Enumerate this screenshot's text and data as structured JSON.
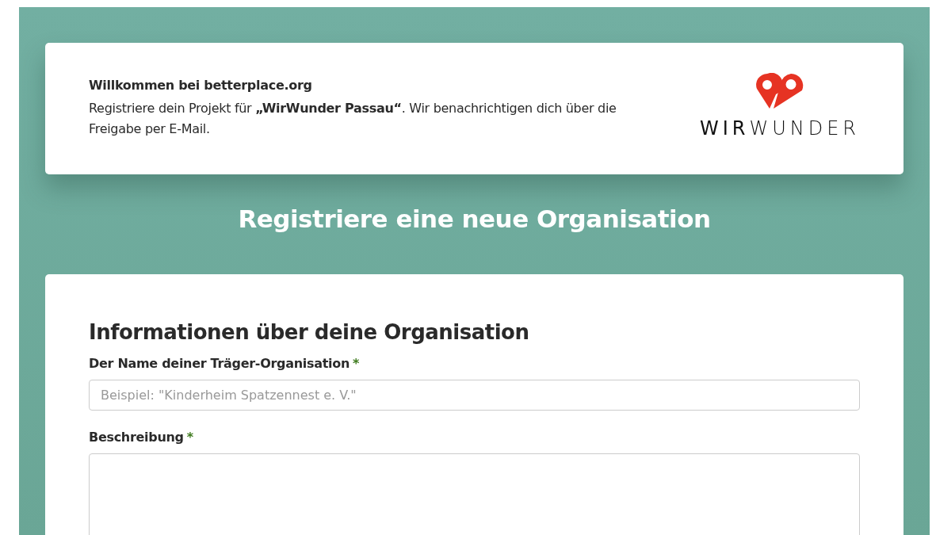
{
  "welcome": {
    "title": "Willkommen bei betterplace.org",
    "text": "Registriere dein Projekt für **„WirWunder Passau“**. Wir benachrichtigen dich über die Freigabe per E-Mail.",
    "logo_text": "**WIR**WUNDER"
  },
  "page_title": "Registriere eine neue Organisation",
  "form": {
    "section_title": "Informationen über deine Organisation",
    "fields": [
      {
        "kind": "input",
        "label": "Der Name deiner Träger-Organisation",
        "required": true,
        "required_mark": "*",
        "placeholder": "Beispiel: \"Kinderheim Spatzennest e. V.\""
      },
      {
        "kind": "textarea",
        "label": "Beschreibung",
        "required": true,
        "required_mark": "*"
      }
    ]
  }
}
